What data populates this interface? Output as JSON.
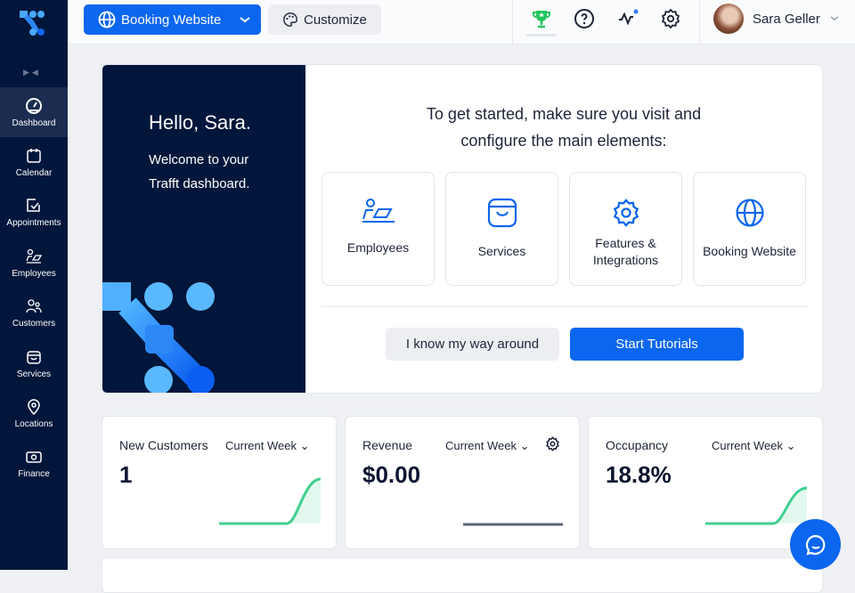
{
  "sidebar": {
    "items": [
      {
        "label": "Dashboard",
        "icon": "gauge-icon"
      },
      {
        "label": "Calendar",
        "icon": "calendar-icon"
      },
      {
        "label": "Appointments",
        "icon": "checkbox-icon"
      },
      {
        "label": "Employees",
        "icon": "employee-desk-icon"
      },
      {
        "label": "Customers",
        "icon": "users-icon"
      },
      {
        "label": "Services",
        "icon": "bag-icon"
      },
      {
        "label": "Locations",
        "icon": "map-pin-icon"
      },
      {
        "label": "Finance",
        "icon": "banknote-icon"
      }
    ]
  },
  "topbar": {
    "booking_label": "Booking Website",
    "customize_label": "Customize",
    "user_name": "Sara Geller"
  },
  "welcome": {
    "hello": "Hello, Sara.",
    "subtitle": "Welcome to your Trafft dashboard.",
    "intro": "To get started, make sure you visit and configure the main elements:",
    "tiles": [
      {
        "label": "Employees"
      },
      {
        "label": "Services"
      },
      {
        "label": "Features & Integrations"
      },
      {
        "label": "Booking Website"
      }
    ],
    "skip_label": "I know my way around",
    "start_label": "Start Tutorials"
  },
  "stats": [
    {
      "title": "New Customers",
      "period": "Current Week",
      "value": "1"
    },
    {
      "title": "Revenue",
      "period": "Current Week",
      "value": "$0.00"
    },
    {
      "title": "Occupancy",
      "period": "Current Week",
      "value": "18.8%"
    }
  ],
  "colors": {
    "primary": "#0b66f0",
    "sidebar": "#00163a",
    "spark_green": "#3ecf8e"
  }
}
